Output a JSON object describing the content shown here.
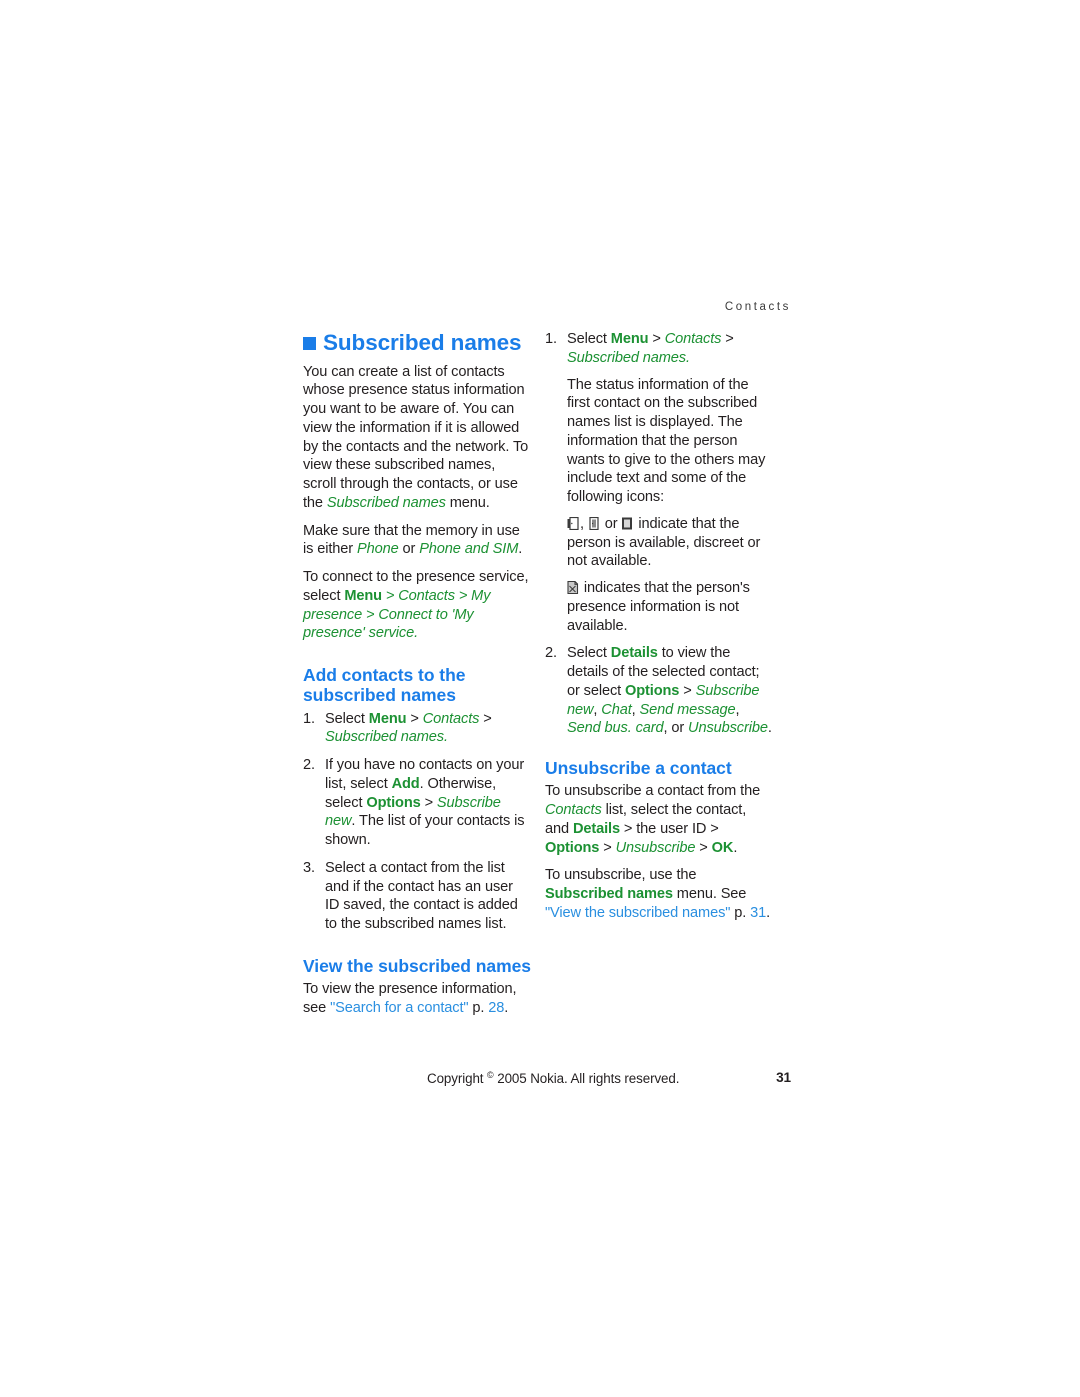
{
  "page": {
    "running_header": "Contacts",
    "footer_copyright_pre": "Copyright",
    "footer_copyright_symbol": "©",
    "footer_copyright_post": "2005 Nokia. All rights reserved.",
    "page_number": "31"
  },
  "colors": {
    "heading_blue": "#1a7de8",
    "link_blue": "#2a8fe0",
    "menu_green": "#1c9133",
    "body_text": "#231f20"
  },
  "left_column": {
    "section_title": "Subscribed names",
    "intro_paragraph": {
      "p1_a": "You can create a list of contacts whose presence status information you want to be aware of. You can view the information if it is allowed by the contacts and the network. To view these subscribed names, scroll through the contacts, or use the ",
      "p1_menu": "Subscribed names",
      "p1_b": " menu."
    },
    "memory_paragraph": {
      "a": "Make sure that the memory in use is either ",
      "m1": "Phone",
      "b": " or ",
      "m2": "Phone and SIM",
      "c": "."
    },
    "presence_paragraph": {
      "a": "To connect to the presence service, select ",
      "menu": "Menu",
      "sep1": " > ",
      "contacts": "Contacts",
      "sep2": " > ",
      "my_presence": "My presence",
      "sep3": " > ",
      "connect": "Connect to 'My presence' service",
      "end": "."
    },
    "add_heading": "Add contacts to the subscribed names",
    "add_steps": [
      {
        "num": "1.",
        "a": "Select ",
        "menu": "Menu",
        "s1": " > ",
        "contacts": "Contacts",
        "s2": " > ",
        "subscribed": "Subscribed names",
        "end": "."
      },
      {
        "num": "2.",
        "a": "If you have no contacts on your list, select ",
        "add": "Add",
        "b": ". Otherwise, select ",
        "options": "Options",
        "s1": " > ",
        "subscribe_new": "Subscribe new",
        "c": ". The list of your contacts is shown."
      },
      {
        "num": "3.",
        "a": "Select a contact from the list and if the contact has an user ID saved, the contact is added to the subscribed names list."
      }
    ],
    "view_heading": "View the subscribed names",
    "view_paragraph": {
      "a": "To view the presence information, see ",
      "link": "\"Search for a contact\"",
      "b": " p. ",
      "page": "28",
      "c": "."
    }
  },
  "right_column": {
    "steps": [
      {
        "num": "1.",
        "a": "Select ",
        "menu": "Menu",
        "s1": " > ",
        "contacts": "Contacts",
        "s2": " > ",
        "subscribed": "Subscribed names",
        "end": ".",
        "continuation": "The status information of the first contact on the subscribed names list is displayed. The information that the person wants to give to the others may include text and some of the following icons:",
        "icon_line_1_a": ", ",
        "icon_line_1_b": " or ",
        "icon_line_1_c": " indicate that the person is available, discreet or not available.",
        "icon_line_2": " indicates that the person's presence information is not available.",
        "icons": [
          "status-available-icon",
          "status-discreet-icon",
          "status-not-available-icon",
          "presence-unavailable-icon"
        ]
      },
      {
        "num": "2.",
        "a": "Select ",
        "details": "Details",
        "b": " to view the details of the selected contact; or select ",
        "options": "Options",
        "s1": " > ",
        "subscribe_new": "Subscribe new",
        "c1": ", ",
        "chat": "Chat",
        "c2": ", ",
        "send_message": "Send message",
        "c3": ", ",
        "send_bus_card": "Send bus. card",
        "c4": ", or ",
        "unsubscribe": "Unsubscribe",
        "end": "."
      }
    ],
    "unsub_heading": "Unsubscribe a contact",
    "unsub_paragraph": {
      "a": "To unsubscribe a contact from the ",
      "contacts": "Contacts",
      "b": " list, select the contact, and ",
      "details": "Details",
      "s1": " > the user ID > ",
      "options": "Options",
      "s2": " > ",
      "unsubscribe": "Unsubscribe",
      "s3": " > ",
      "ok": "OK",
      "end": "."
    },
    "unsub_paragraph2": {
      "a": "To unsubscribe, use the ",
      "subscribed_names": "Subscribed names",
      "b": " menu. See ",
      "link": "\"View the subscribed names\"",
      "c": " p. ",
      "page": "31",
      "d": "."
    }
  }
}
